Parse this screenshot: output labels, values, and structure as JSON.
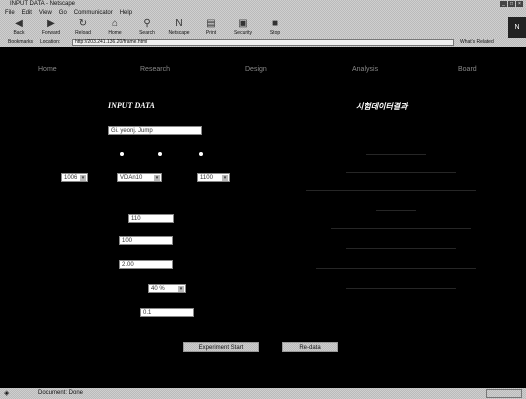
{
  "window": {
    "title": "INPUT DATA - Netscape"
  },
  "menu": [
    "File",
    "Edit",
    "View",
    "Go",
    "Communicator",
    "Help"
  ],
  "toolbar": [
    "Back",
    "Forward",
    "Reload",
    "Home",
    "Search",
    "Netscape",
    "Print",
    "Security",
    "Stop"
  ],
  "location": {
    "bookmarks": "Bookmarks",
    "label": "Location:",
    "url": "http://203.241.136.20/frame.html",
    "related": "What's Related"
  },
  "nav": [
    "Home",
    "Research",
    "Design",
    "Analysis",
    "Board"
  ],
  "input": {
    "heading": "INPUT DATA",
    "name_value": "Gi. yeonj. Jump",
    "select1": "1006",
    "select2": "VDAn10",
    "select3": "1100",
    "field_a": "110",
    "field_b": "100",
    "field_c": "2.00",
    "percent": "40 %",
    "field_d": "0.1"
  },
  "results": {
    "heading": "시험데이터결과"
  },
  "buttons": {
    "run": "Experiment Start",
    "reset": "Re-data"
  },
  "status": {
    "text": "Document: Done"
  }
}
